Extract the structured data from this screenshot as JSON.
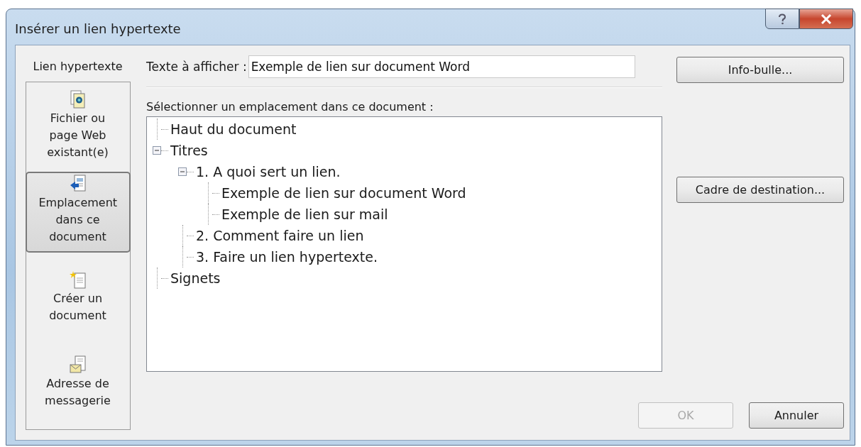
{
  "window": {
    "title": "Insérer un lien hypertexte"
  },
  "sidebar": {
    "label": "Lien hypertexte",
    "items": [
      {
        "label": "Fichier ou page Web existant(e)",
        "selected": false
      },
      {
        "label": "Emplacement dans ce document",
        "selected": true
      },
      {
        "label": "Créer un document",
        "selected": false
      },
      {
        "label": "Adresse de messagerie",
        "selected": false
      }
    ]
  },
  "display_text": {
    "label": "Texte à afficher :",
    "value": "Exemple de lien sur document Word"
  },
  "tooltip_button": "Info-bulle...",
  "location": {
    "label": "Sélectionner un emplacement dans ce document :",
    "tree": [
      {
        "label": "Haut du document"
      },
      {
        "label": "Titres",
        "expanded": true,
        "children": [
          {
            "label": "1. A quoi sert un lien.",
            "expanded": true,
            "children": [
              {
                "label": "Exemple de lien sur document Word"
              },
              {
                "label": "Exemple de lien sur mail"
              }
            ]
          },
          {
            "label": "2. Comment faire un lien"
          },
          {
            "label": "3. Faire un lien hypertexte."
          }
        ]
      },
      {
        "label": "Signets"
      }
    ]
  },
  "target_frame_button": "Cadre de destination...",
  "buttons": [
    {
      "label": "OK",
      "disabled": true
    },
    {
      "label": "Annuler",
      "disabled": false
    }
  ]
}
